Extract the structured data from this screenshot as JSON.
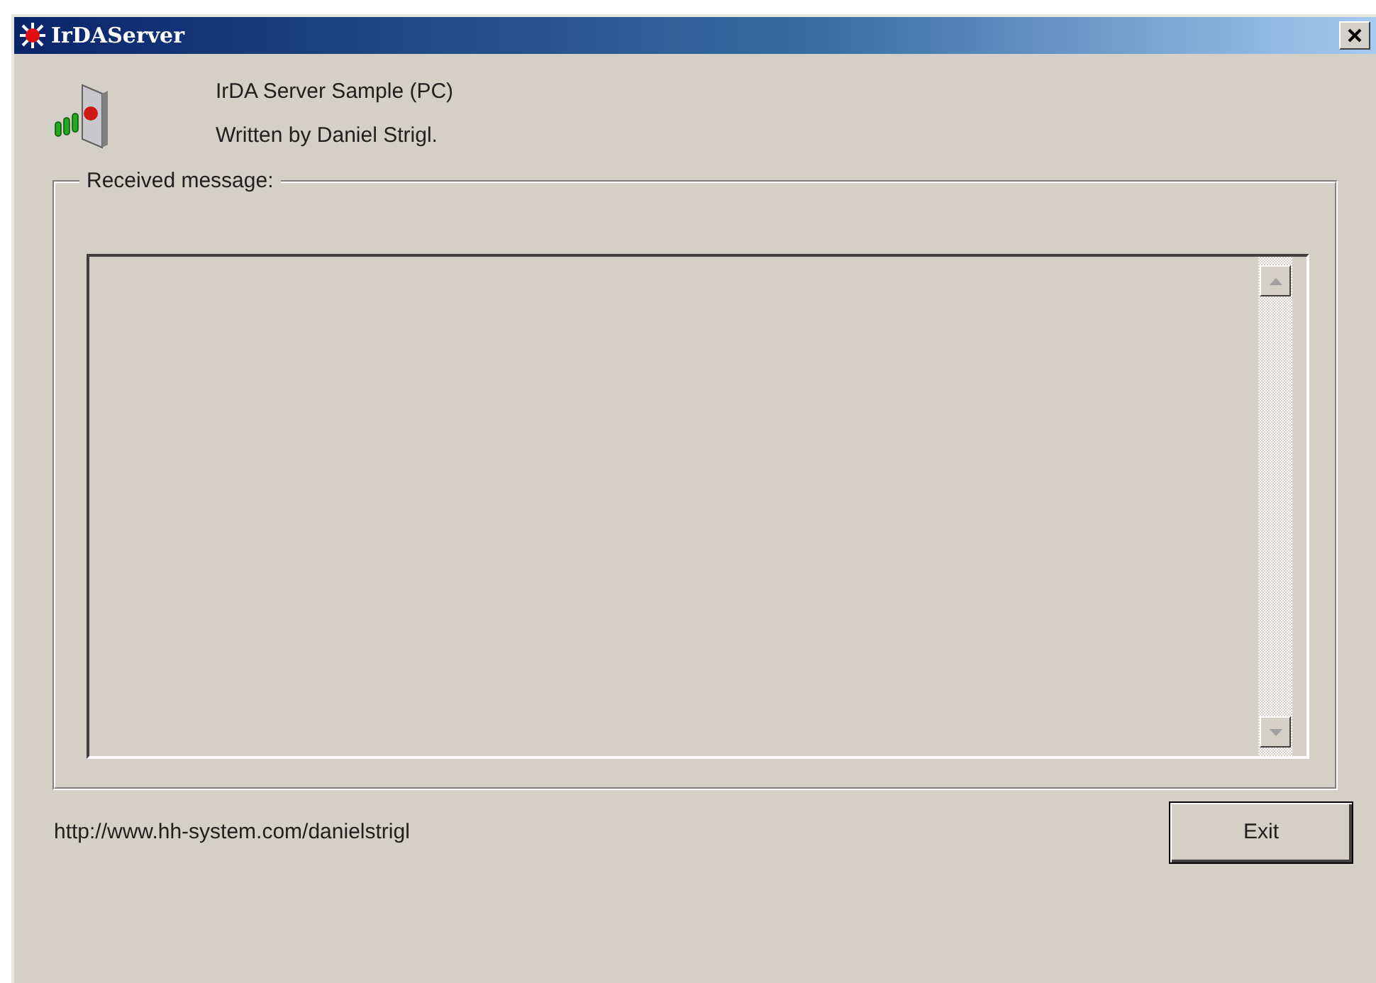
{
  "window": {
    "title": "IrDAServer"
  },
  "header": {
    "lines": [
      "IrDA Server Sample (PC)",
      "Written by Daniel Strigl."
    ]
  },
  "received_group": {
    "label": "Received message:"
  },
  "footer": {
    "url": "http://www.hh-system.com/danielstrigl",
    "buttons": [
      "Exit"
    ]
  }
}
